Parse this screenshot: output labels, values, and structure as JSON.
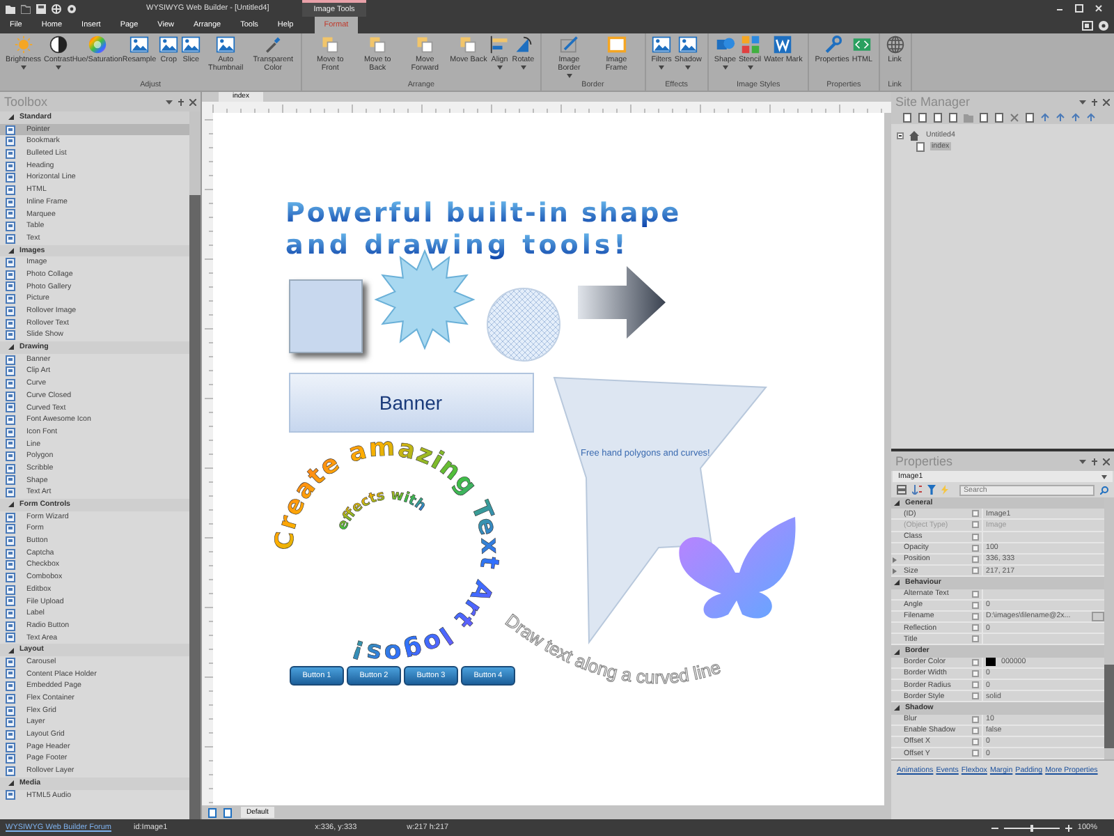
{
  "title_bar": {
    "title": "WYSIWYG Web Builder - [Untitled4]",
    "context_label": "Image Tools"
  },
  "menu_tabs": [
    {
      "label": "File",
      "selected": false
    },
    {
      "label": "Home",
      "selected": false
    },
    {
      "label": "Insert",
      "selected": false
    },
    {
      "label": "Page",
      "selected": false
    },
    {
      "label": "View",
      "selected": false
    },
    {
      "label": "Arrange",
      "selected": false
    },
    {
      "label": "Tools",
      "selected": false
    },
    {
      "label": "Help",
      "selected": false
    },
    {
      "label": "Format",
      "selected": true
    }
  ],
  "ribbon_groups": [
    {
      "label": "Adjust",
      "buttons": [
        {
          "label": "Brightness",
          "dropdown": true
        },
        {
          "label": "Contrast",
          "dropdown": true
        },
        {
          "label": "Hue/Saturation",
          "dropdown": false
        },
        {
          "label": "Resample",
          "dropdown": false
        },
        {
          "label": "Crop",
          "dropdown": false
        },
        {
          "label": "Slice",
          "dropdown": false
        },
        {
          "label": "Auto Thumbnail",
          "dropdown": false
        },
        {
          "label": "Transparent Color",
          "dropdown": false
        }
      ]
    },
    {
      "label": "Arrange",
      "buttons": [
        {
          "label": "Move to Front",
          "dropdown": false
        },
        {
          "label": "Move to Back",
          "dropdown": false
        },
        {
          "label": "Move Forward",
          "dropdown": false
        },
        {
          "label": "Move Back",
          "dropdown": false
        },
        {
          "label": "Align",
          "dropdown": true
        },
        {
          "label": "Rotate",
          "dropdown": true
        }
      ]
    },
    {
      "label": "Border",
      "buttons": [
        {
          "label": "Image Border",
          "dropdown": true
        },
        {
          "label": "Image Frame",
          "dropdown": false
        }
      ]
    },
    {
      "label": "Effects",
      "buttons": [
        {
          "label": "Filters",
          "dropdown": true
        },
        {
          "label": "Shadow",
          "dropdown": true
        }
      ]
    },
    {
      "label": "Image Styles",
      "buttons": [
        {
          "label": "Shape",
          "dropdown": true
        },
        {
          "label": "Stencil",
          "dropdown": true
        },
        {
          "label": "Water Mark",
          "dropdown": false
        }
      ]
    },
    {
      "label": "Properties",
      "buttons": [
        {
          "label": "Properties",
          "dropdown": false
        },
        {
          "label": "HTML",
          "dropdown": false
        }
      ]
    },
    {
      "label": "Link",
      "buttons": [
        {
          "label": "Link",
          "dropdown": false
        }
      ]
    }
  ],
  "toolbox": {
    "title": "Toolbox",
    "categories": [
      {
        "label": "Standard",
        "expanded": true,
        "items": [
          {
            "label": "Pointer",
            "selected": true
          },
          {
            "label": "Bookmark",
            "selected": false
          },
          {
            "label": "Bulleted List",
            "selected": false
          },
          {
            "label": "Heading",
            "selected": false
          },
          {
            "label": "Horizontal Line",
            "selected": false
          },
          {
            "label": "HTML",
            "selected": false
          },
          {
            "label": "Inline Frame",
            "selected": false
          },
          {
            "label": "Marquee",
            "selected": false
          },
          {
            "label": "Table",
            "selected": false
          },
          {
            "label": "Text",
            "selected": false
          }
        ]
      },
      {
        "label": "Images",
        "expanded": true,
        "items": [
          {
            "label": "Image",
            "selected": false
          },
          {
            "label": "Photo Collage",
            "selected": false
          },
          {
            "label": "Photo Gallery",
            "selected": false
          },
          {
            "label": "Picture",
            "selected": false
          },
          {
            "label": "Rollover Image",
            "selected": false
          },
          {
            "label": "Rollover Text",
            "selected": false
          },
          {
            "label": "Slide Show",
            "selected": false
          }
        ]
      },
      {
        "label": "Drawing",
        "expanded": true,
        "items": [
          {
            "label": "Banner",
            "selected": false
          },
          {
            "label": "Clip Art",
            "selected": false
          },
          {
            "label": "Curve",
            "selected": false
          },
          {
            "label": "Curve Closed",
            "selected": false
          },
          {
            "label": "Curved Text",
            "selected": false
          },
          {
            "label": "Font Awesome Icon",
            "selected": false
          },
          {
            "label": "Icon Font",
            "selected": false
          },
          {
            "label": "Line",
            "selected": false
          },
          {
            "label": "Polygon",
            "selected": false
          },
          {
            "label": "Scribble",
            "selected": false
          },
          {
            "label": "Shape",
            "selected": false
          },
          {
            "label": "Text Art",
            "selected": false
          }
        ]
      },
      {
        "label": "Form Controls",
        "expanded": true,
        "items": [
          {
            "label": "Form Wizard",
            "selected": false
          },
          {
            "label": "Form",
            "selected": false
          },
          {
            "label": "Button",
            "selected": false
          },
          {
            "label": "Captcha",
            "selected": false
          },
          {
            "label": "Checkbox",
            "selected": false
          },
          {
            "label": "Combobox",
            "selected": false
          },
          {
            "label": "Editbox",
            "selected": false
          },
          {
            "label": "File Upload",
            "selected": false
          },
          {
            "label": "Label",
            "selected": false
          },
          {
            "label": "Radio Button",
            "selected": false
          },
          {
            "label": "Text Area",
            "selected": false
          }
        ]
      },
      {
        "label": "Layout",
        "expanded": true,
        "items": [
          {
            "label": "Carousel",
            "selected": false
          },
          {
            "label": "Content Place Holder",
            "selected": false
          },
          {
            "label": "Embedded Page",
            "selected": false
          },
          {
            "label": "Flex Container",
            "selected": false
          },
          {
            "label": "Flex Grid",
            "selected": false
          },
          {
            "label": "Layer",
            "selected": false
          },
          {
            "label": "Layout Grid",
            "selected": false
          },
          {
            "label": "Page Header",
            "selected": false
          },
          {
            "label": "Page Footer",
            "selected": false
          },
          {
            "label": "Rollover Layer",
            "selected": false
          }
        ]
      },
      {
        "label": "Media",
        "expanded": true,
        "items": [
          {
            "label": "HTML5 Audio",
            "selected": false
          }
        ]
      }
    ]
  },
  "document_tabs": [
    {
      "label": "index",
      "selected": true
    }
  ],
  "canvas": {
    "headline": [
      "Powerful built-in shape",
      "and drawing tools!"
    ],
    "banner_text": "Banner",
    "polygon_text": "Free hand polygons and curves!",
    "spiral_text": [
      "Create amazing Text Art logos!",
      "effects with"
    ],
    "curved_text": "Draw text along a curved line",
    "buttons": [
      "Button 1",
      "Button 2",
      "Button 3",
      "Button 4"
    ]
  },
  "page_tabs": [
    {
      "label": "Default",
      "selected": true
    }
  ],
  "site_manager": {
    "title": "Site Manager",
    "tree": [
      {
        "label": "Untitled4",
        "expanded": true,
        "selected": false,
        "children": [
          {
            "label": "index",
            "selected": true
          }
        ]
      }
    ]
  },
  "properties": {
    "title": "Properties",
    "object": "Image1",
    "search_placeholder": "Search",
    "groups": [
      {
        "label": "General",
        "expanded": true,
        "rows": [
          {
            "name": "(ID)",
            "value": "Image1",
            "kind": "text",
            "expandable": false,
            "disabled": false
          },
          {
            "name": "(Object Type)",
            "value": "Image",
            "kind": "text",
            "expandable": false,
            "disabled": true
          },
          {
            "name": "Class",
            "kind": "text",
            "expandable": false,
            "disabled": false
          },
          {
            "name": "Opacity",
            "value": "100",
            "kind": "text",
            "expandable": false,
            "disabled": false
          },
          {
            "name": "Position",
            "value": "336, 333",
            "kind": "text",
            "expandable": true,
            "disabled": false
          },
          {
            "name": "Size",
            "value": "217, 217",
            "kind": "text",
            "expandable": true,
            "disabled": false
          }
        ]
      },
      {
        "label": "Behaviour",
        "expanded": true,
        "rows": [
          {
            "name": "Alternate Text",
            "kind": "text",
            "expandable": false,
            "disabled": false
          },
          {
            "name": "Angle",
            "value": "0",
            "kind": "text",
            "expandable": false,
            "disabled": false
          },
          {
            "name": "Filename",
            "value": "D:\\images\\filename@2x...",
            "kind": "file",
            "expandable": false,
            "disabled": false
          },
          {
            "name": "Reflection",
            "value": "0",
            "kind": "text",
            "expandable": false,
            "disabled": false
          },
          {
            "name": "Title",
            "kind": "text",
            "expandable": false,
            "disabled": false
          }
        ]
      },
      {
        "label": "Border",
        "expanded": true,
        "rows": [
          {
            "name": "Border Color",
            "value": "000000",
            "kind": "color",
            "color": "#000000",
            "expandable": false,
            "disabled": false
          },
          {
            "name": "Border Width",
            "value": "0",
            "kind": "text",
            "expandable": false,
            "disabled": false
          },
          {
            "name": "Border Radius",
            "value": "0",
            "kind": "text",
            "expandable": false,
            "disabled": false
          },
          {
            "name": "Border Style",
            "value": "solid",
            "kind": "text",
            "expandable": false,
            "disabled": false
          }
        ]
      },
      {
        "label": "Shadow",
        "expanded": true,
        "rows": [
          {
            "name": "Blur",
            "value": "10",
            "kind": "text",
            "expandable": false,
            "disabled": false
          },
          {
            "name": "Enable Shadow",
            "value": "false",
            "kind": "text",
            "expandable": false,
            "disabled": false
          },
          {
            "name": "Offset X",
            "value": "0",
            "kind": "text",
            "expandable": false,
            "disabled": false
          },
          {
            "name": "Offset Y",
            "value": "0",
            "kind": "text",
            "expandable": false,
            "disabled": false
          }
        ]
      }
    ],
    "links": [
      "Animations",
      "Events",
      "Flexbox",
      "Margin",
      "Padding",
      "More Properties"
    ]
  },
  "status_bar": {
    "link": "WYSIWYG Web Builder Forum",
    "object_id": "id:Image1",
    "position": "x:336, y:333",
    "size": "w:217 h:217",
    "zoom": {
      "level": 0.5,
      "reading": "100%"
    }
  }
}
